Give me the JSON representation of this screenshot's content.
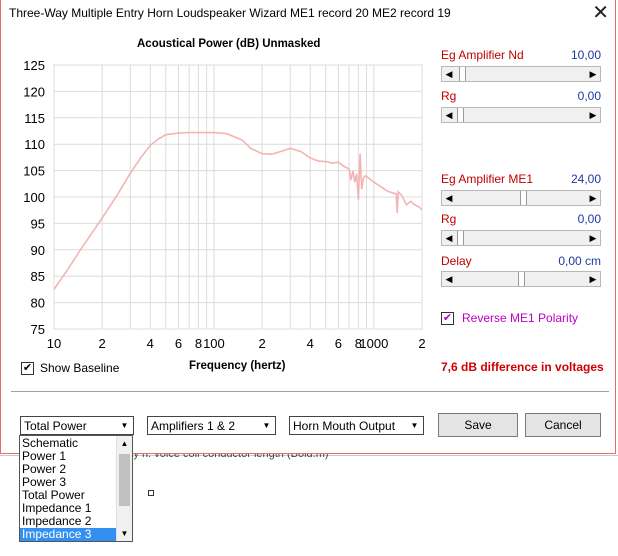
{
  "background": {
    "fragment_text": "ky n. voice coil conductor length  (Bold.m)"
  },
  "window": {
    "title": "Three-Way Multiple Entry Horn Loudspeaker Wizard   ME1 record 20   ME2 record 19",
    "close_label": "✕"
  },
  "chart": {
    "title": "Acoustical Power (dB)   Unmasked",
    "xlabel": "Frequency (hertz)"
  },
  "chart_data": {
    "type": "line",
    "title": "Acoustical Power (dB)   Unmasked",
    "xlabel": "Frequency (hertz)",
    "ylabel": "",
    "x_scale": "log",
    "xlim": [
      10,
      2000
    ],
    "ylim": [
      75,
      125
    ],
    "grid": true,
    "y_ticks": [
      75,
      80,
      85,
      90,
      95,
      100,
      105,
      110,
      115,
      120,
      125
    ],
    "x_tick_labels": [
      {
        "x": 10,
        "label": "10"
      },
      {
        "x": 20,
        "label": "2"
      },
      {
        "x": 40,
        "label": "4"
      },
      {
        "x": 60,
        "label": "6"
      },
      {
        "x": 80,
        "label": "8"
      },
      {
        "x": 100,
        "label": "100"
      },
      {
        "x": 200,
        "label": "2"
      },
      {
        "x": 400,
        "label": "4"
      },
      {
        "x": 600,
        "label": "6"
      },
      {
        "x": 800,
        "label": "8"
      },
      {
        "x": 1000,
        "label": "1000"
      },
      {
        "x": 2000,
        "label": "2"
      }
    ],
    "series": [
      {
        "color": "#f4b4b4",
        "x": [
          10,
          12,
          15,
          20,
          25,
          30,
          35,
          40,
          45,
          50,
          60,
          70,
          80,
          100,
          120,
          150,
          170,
          200,
          230,
          260,
          300,
          350,
          400,
          450,
          500,
          550,
          600,
          650,
          700,
          720,
          740,
          760,
          780,
          800,
          820,
          840,
          860,
          880,
          900,
          1000,
          1100,
          1200,
          1300,
          1380,
          1400,
          1420,
          1500,
          1600,
          1700,
          1800,
          1900,
          2000
        ],
        "values": [
          82.5,
          86,
          90.5,
          96,
          100.5,
          104.5,
          107.5,
          109.8,
          111,
          111.8,
          112.1,
          112.2,
          112.2,
          112.2,
          112,
          110.8,
          109.2,
          108.2,
          108.1,
          108.6,
          109.2,
          108.6,
          107.4,
          106.8,
          106.7,
          106.4,
          106.6,
          105.8,
          105.3,
          103.2,
          105,
          102.8,
          104.4,
          99.5,
          108.2,
          101.5,
          103.6,
          104,
          103.9,
          102.8,
          102,
          101.2,
          100.8,
          100.6,
          97,
          101,
          100.2,
          98.5,
          99.2,
          98.5,
          98.2,
          97.6
        ]
      }
    ]
  },
  "baseline": {
    "label": "Show Baseline",
    "checked": true
  },
  "difference_text": "7,6 dB difference in voltages",
  "controls": [
    {
      "label": "Eg  Amplifier  Nd",
      "value": "10,00",
      "level": 0.02
    },
    {
      "label": "Rg",
      "value": "0,00",
      "level": 0.0
    },
    {
      "label": "Eg  Amplifier  ME1",
      "value": "24,00",
      "level": 0.52
    },
    {
      "label": "Rg",
      "value": "0,00",
      "level": 0.0
    },
    {
      "label": "Delay",
      "value": "0,00 cm",
      "level": 0.5
    }
  ],
  "reverse_polarity": {
    "label": "Reverse ME1 Polarity",
    "checked": true
  },
  "dropdowns": {
    "plot_type": "Total Power",
    "amplifiers": "Amplifiers 1 & 2",
    "output": "Horn Mouth Output"
  },
  "buttons": {
    "save": "Save",
    "cancel": "Cancel"
  },
  "plot_list": {
    "items": [
      "Schematic",
      "Power 1",
      "Power 2",
      "Power 3",
      "Total Power",
      "Impedance 1",
      "Impedance 2",
      "Impedance 3"
    ],
    "selected": "Impedance 3"
  },
  "icons": {
    "checkbox_mark": "✔",
    "arrow_left": "◀",
    "arrow_right": "▶",
    "arrow_down": "▼",
    "arrow_up": "▲"
  }
}
